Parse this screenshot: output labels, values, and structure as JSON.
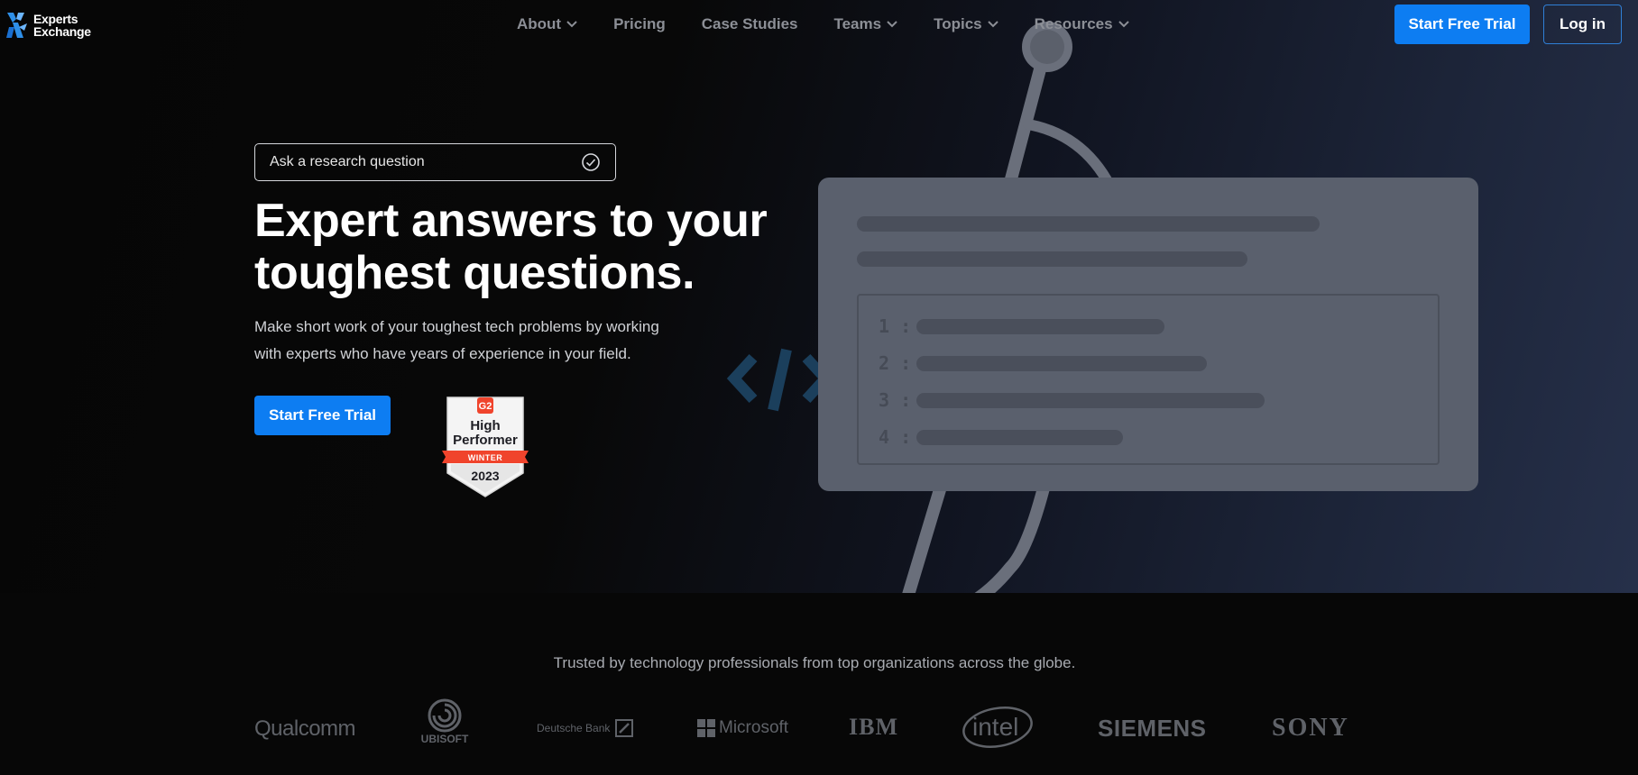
{
  "brand": {
    "line1": "Experts",
    "line2": "Exchange",
    "icon": "experts-exchange-logo-icon"
  },
  "nav": {
    "items": [
      {
        "label": "About",
        "dropdown": true
      },
      {
        "label": "Pricing",
        "dropdown": false
      },
      {
        "label": "Case Studies",
        "dropdown": false
      },
      {
        "label": "Teams",
        "dropdown": true
      },
      {
        "label": "Topics",
        "dropdown": true
      },
      {
        "label": "Resources",
        "dropdown": true
      }
    ],
    "cta_label": "Start Free Trial",
    "login_label": "Log in"
  },
  "hero": {
    "search_placeholder": "Ask a research question",
    "headline_line1": "Expert answers to your",
    "headline_line2": "toughest questions.",
    "subtext_line1": "Make short work of your toughest tech problems by working",
    "subtext_line2": "with experts who have years of experience in your field.",
    "cta_label": "Start Free Trial"
  },
  "badge": {
    "line1": "High",
    "line2": "Performer",
    "season": "WINTER",
    "year": "2023",
    "brand": "G2"
  },
  "illustration": {
    "list_numbers": [
      "1 :",
      "2 :",
      "3 :",
      "4 :"
    ]
  },
  "trusted": {
    "text": "Trusted by technology professionals from top organizations across the globe.",
    "logos": [
      "Qualcomm",
      "UBISOFT",
      "Deutsche Bank",
      "Microsoft",
      "IBM",
      "intel",
      "SIEMENS",
      "SONY"
    ]
  },
  "colors": {
    "accent": "#0d7df2",
    "nav_text": "#8c8f96",
    "logo_gray": "#5f6268",
    "badge_red": "#f0442c"
  }
}
